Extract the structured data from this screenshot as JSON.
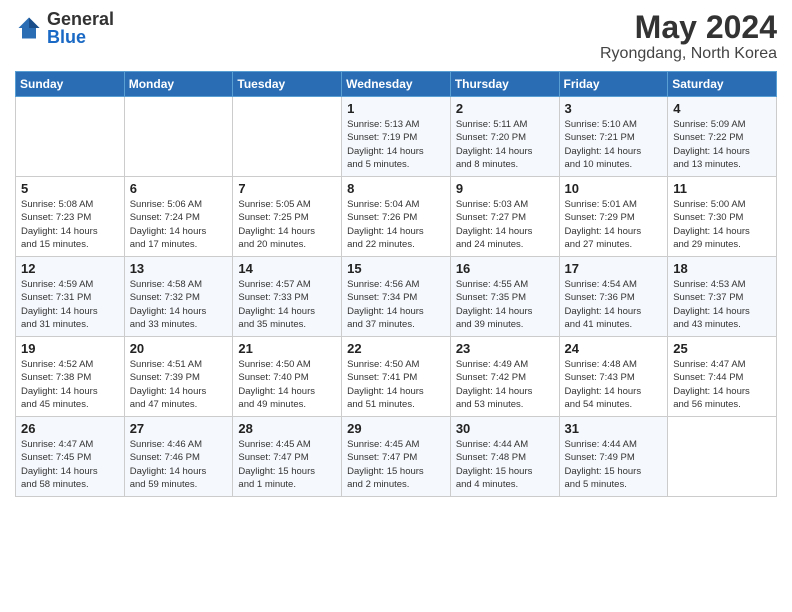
{
  "header": {
    "logo_general": "General",
    "logo_blue": "Blue",
    "month_title": "May 2024",
    "location": "Ryongdang, North Korea"
  },
  "columns": [
    "Sunday",
    "Monday",
    "Tuesday",
    "Wednesday",
    "Thursday",
    "Friday",
    "Saturday"
  ],
  "weeks": [
    [
      {
        "day": "",
        "info": ""
      },
      {
        "day": "",
        "info": ""
      },
      {
        "day": "",
        "info": ""
      },
      {
        "day": "1",
        "info": "Sunrise: 5:13 AM\nSunset: 7:19 PM\nDaylight: 14 hours\nand 5 minutes."
      },
      {
        "day": "2",
        "info": "Sunrise: 5:11 AM\nSunset: 7:20 PM\nDaylight: 14 hours\nand 8 minutes."
      },
      {
        "day": "3",
        "info": "Sunrise: 5:10 AM\nSunset: 7:21 PM\nDaylight: 14 hours\nand 10 minutes."
      },
      {
        "day": "4",
        "info": "Sunrise: 5:09 AM\nSunset: 7:22 PM\nDaylight: 14 hours\nand 13 minutes."
      }
    ],
    [
      {
        "day": "5",
        "info": "Sunrise: 5:08 AM\nSunset: 7:23 PM\nDaylight: 14 hours\nand 15 minutes."
      },
      {
        "day": "6",
        "info": "Sunrise: 5:06 AM\nSunset: 7:24 PM\nDaylight: 14 hours\nand 17 minutes."
      },
      {
        "day": "7",
        "info": "Sunrise: 5:05 AM\nSunset: 7:25 PM\nDaylight: 14 hours\nand 20 minutes."
      },
      {
        "day": "8",
        "info": "Sunrise: 5:04 AM\nSunset: 7:26 PM\nDaylight: 14 hours\nand 22 minutes."
      },
      {
        "day": "9",
        "info": "Sunrise: 5:03 AM\nSunset: 7:27 PM\nDaylight: 14 hours\nand 24 minutes."
      },
      {
        "day": "10",
        "info": "Sunrise: 5:01 AM\nSunset: 7:29 PM\nDaylight: 14 hours\nand 27 minutes."
      },
      {
        "day": "11",
        "info": "Sunrise: 5:00 AM\nSunset: 7:30 PM\nDaylight: 14 hours\nand 29 minutes."
      }
    ],
    [
      {
        "day": "12",
        "info": "Sunrise: 4:59 AM\nSunset: 7:31 PM\nDaylight: 14 hours\nand 31 minutes."
      },
      {
        "day": "13",
        "info": "Sunrise: 4:58 AM\nSunset: 7:32 PM\nDaylight: 14 hours\nand 33 minutes."
      },
      {
        "day": "14",
        "info": "Sunrise: 4:57 AM\nSunset: 7:33 PM\nDaylight: 14 hours\nand 35 minutes."
      },
      {
        "day": "15",
        "info": "Sunrise: 4:56 AM\nSunset: 7:34 PM\nDaylight: 14 hours\nand 37 minutes."
      },
      {
        "day": "16",
        "info": "Sunrise: 4:55 AM\nSunset: 7:35 PM\nDaylight: 14 hours\nand 39 minutes."
      },
      {
        "day": "17",
        "info": "Sunrise: 4:54 AM\nSunset: 7:36 PM\nDaylight: 14 hours\nand 41 minutes."
      },
      {
        "day": "18",
        "info": "Sunrise: 4:53 AM\nSunset: 7:37 PM\nDaylight: 14 hours\nand 43 minutes."
      }
    ],
    [
      {
        "day": "19",
        "info": "Sunrise: 4:52 AM\nSunset: 7:38 PM\nDaylight: 14 hours\nand 45 minutes."
      },
      {
        "day": "20",
        "info": "Sunrise: 4:51 AM\nSunset: 7:39 PM\nDaylight: 14 hours\nand 47 minutes."
      },
      {
        "day": "21",
        "info": "Sunrise: 4:50 AM\nSunset: 7:40 PM\nDaylight: 14 hours\nand 49 minutes."
      },
      {
        "day": "22",
        "info": "Sunrise: 4:50 AM\nSunset: 7:41 PM\nDaylight: 14 hours\nand 51 minutes."
      },
      {
        "day": "23",
        "info": "Sunrise: 4:49 AM\nSunset: 7:42 PM\nDaylight: 14 hours\nand 53 minutes."
      },
      {
        "day": "24",
        "info": "Sunrise: 4:48 AM\nSunset: 7:43 PM\nDaylight: 14 hours\nand 54 minutes."
      },
      {
        "day": "25",
        "info": "Sunrise: 4:47 AM\nSunset: 7:44 PM\nDaylight: 14 hours\nand 56 minutes."
      }
    ],
    [
      {
        "day": "26",
        "info": "Sunrise: 4:47 AM\nSunset: 7:45 PM\nDaylight: 14 hours\nand 58 minutes."
      },
      {
        "day": "27",
        "info": "Sunrise: 4:46 AM\nSunset: 7:46 PM\nDaylight: 14 hours\nand 59 minutes."
      },
      {
        "day": "28",
        "info": "Sunrise: 4:45 AM\nSunset: 7:47 PM\nDaylight: 15 hours\nand 1 minute."
      },
      {
        "day": "29",
        "info": "Sunrise: 4:45 AM\nSunset: 7:47 PM\nDaylight: 15 hours\nand 2 minutes."
      },
      {
        "day": "30",
        "info": "Sunrise: 4:44 AM\nSunset: 7:48 PM\nDaylight: 15 hours\nand 4 minutes."
      },
      {
        "day": "31",
        "info": "Sunrise: 4:44 AM\nSunset: 7:49 PM\nDaylight: 15 hours\nand 5 minutes."
      },
      {
        "day": "",
        "info": ""
      }
    ]
  ]
}
